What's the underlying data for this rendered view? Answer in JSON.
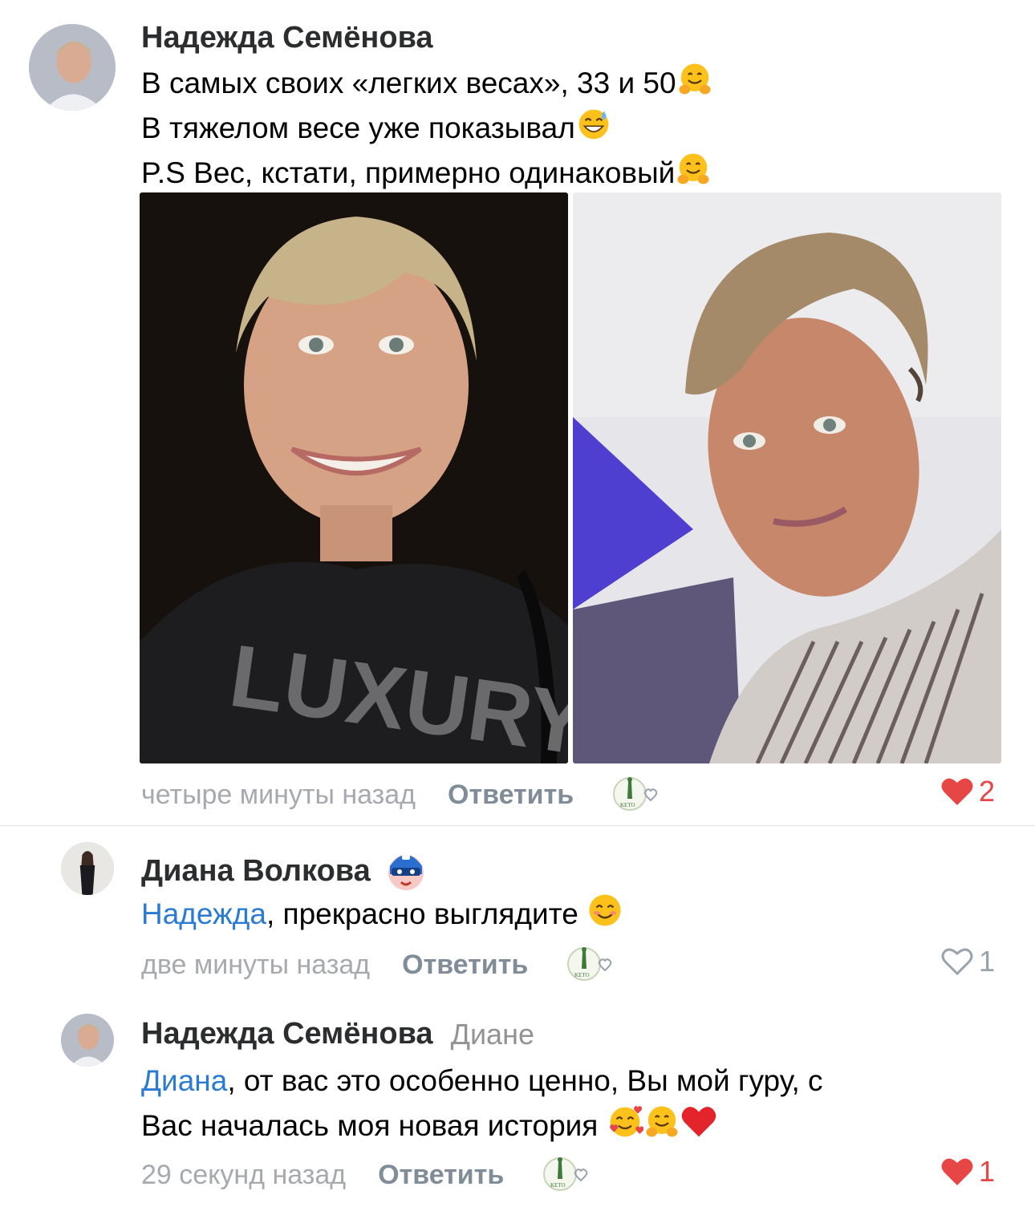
{
  "comments": [
    {
      "author": "Надежда Семёнова",
      "lines": [
        "В самых своих «легких весах», 33 и 50",
        "В тяжелом весе уже показывал",
        "P.S Вес, кстати, примерно одинаковый"
      ],
      "time": "четыре минуты назад",
      "reply_label": "Ответить",
      "likes": "2"
    },
    {
      "author": "Диана Волкова",
      "mention": "Надежда",
      "text": ", прекрасно выглядите ",
      "time": "две минуты назад",
      "reply_label": "Ответить",
      "likes": "1"
    },
    {
      "author": "Надежда Семёнова",
      "reply_to": "Диане",
      "mention": "Диана",
      "line1": ", от вас это особенно ценно, Вы мой гуру, с",
      "line2": "Вас началась моя новая история ",
      "time": "29 секунд назад",
      "reply_label": "Ответить",
      "likes": "1"
    }
  ],
  "keto_logo_text": "KETO",
  "icons": {
    "hug": "hugging-face-emoji",
    "sweat": "grinning-sweat-emoji",
    "smile": "smiling-face-emoji",
    "hearts": "smiling-face-with-hearts-emoji",
    "heart": "red-heart-emoji",
    "mask": "masked-avatar-badge"
  },
  "colors": {
    "accent_link": "#2a7bd4",
    "like_active": "#e64646",
    "meta_text": "#a6a9ae"
  }
}
